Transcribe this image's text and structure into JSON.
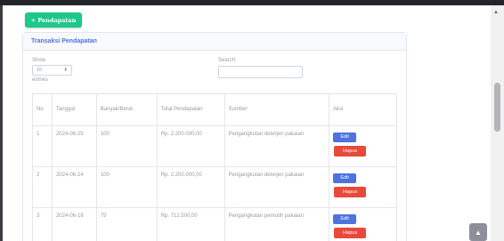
{
  "toolbar": {
    "add_label": "+ Pendapatan"
  },
  "card": {
    "title": "Transaksi Pendapatan"
  },
  "controls": {
    "show_label": "Show",
    "page_size": "10",
    "entries_label": "entries",
    "search_label": "Search:",
    "search_value": ""
  },
  "table": {
    "headers": [
      "No",
      "Tanggal",
      "Banyak/Berat",
      "Total Pendapatan",
      "Sumber",
      "Aksi"
    ],
    "rows": [
      {
        "no": "1",
        "tanggal": "2024-06-25",
        "banyak": "100",
        "total": "Rp. 2.200.000,00",
        "sumber": "Pengangkutan deterjen pakaian"
      },
      {
        "no": "2",
        "tanggal": "2024-06-24",
        "banyak": "100",
        "total": "Rp. 2.200.000,00",
        "sumber": "Pengangkutan deterjen pakaian"
      },
      {
        "no": "3",
        "tanggal": "2024-06-18",
        "banyak": "75",
        "total": "Rp. 712.500,00",
        "sumber": "Pengangkutan pemutih pakaian"
      }
    ],
    "edit_label": "Edit",
    "delete_label": "Hapus"
  },
  "scroll": {
    "up_icon": "arrow-up-icon",
    "top_icon": "chevron-up-icon"
  },
  "colors": {
    "success": "#1cc88a",
    "primary": "#4e73df",
    "danger": "#e74a3b"
  }
}
